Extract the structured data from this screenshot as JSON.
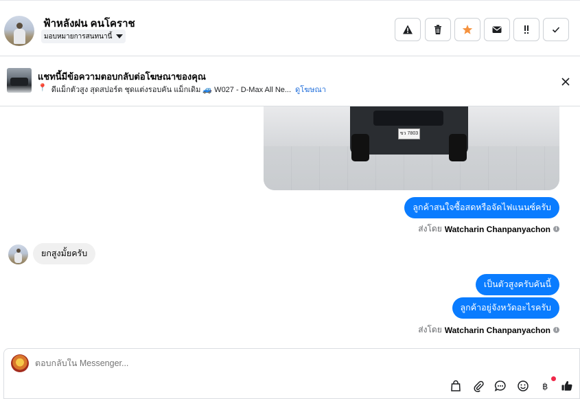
{
  "header": {
    "contact_name": "ฟ้าหลังฝน คนโคราช",
    "assign_label": "มอบหมายการสนทนานี้",
    "actions": [
      {
        "icon": "warning-icon"
      },
      {
        "icon": "trash-icon"
      },
      {
        "icon": "star-icon"
      },
      {
        "icon": "envelope-icon"
      },
      {
        "icon": "follow-up-icon"
      },
      {
        "icon": "check-icon"
      }
    ],
    "accent_star": "#f5923e"
  },
  "ad": {
    "title": "แชทนี้มีข้อความตอบกลับต่อโฆษณาของคุณ",
    "pin": "📍",
    "detail": "ดีแม็กตัวสูง สุดสปอร์ต ชุดแต่งรอบคัน แม็กเดิม 🚙 W027 - D-Max All Ne...",
    "link": "ดูโฆษณา"
  },
  "photo": {
    "plate": "ขว 7803"
  },
  "messages": {
    "out1": "ลูกค้าสนใจซื้อสดหรือจัดไฟแนนซ์ครับ",
    "sent_prefix": "ส่งโดย",
    "agent": "Watcharin Chanpanyachon",
    "in1": "ยกสูงมั้ยครับ",
    "out2": "เป็นตัวสูงครับคันนี้",
    "out3": "ลูกค้าอยู่จังหวัดอะไรครับ"
  },
  "composer": {
    "placeholder": "ตอบกลับใน Messenger...",
    "tools": [
      "bag-icon",
      "paperclip-icon",
      "saved-reply-icon",
      "emoji-icon",
      "payment-icon",
      "like-icon"
    ],
    "brand_blue": "#0a7cff"
  }
}
